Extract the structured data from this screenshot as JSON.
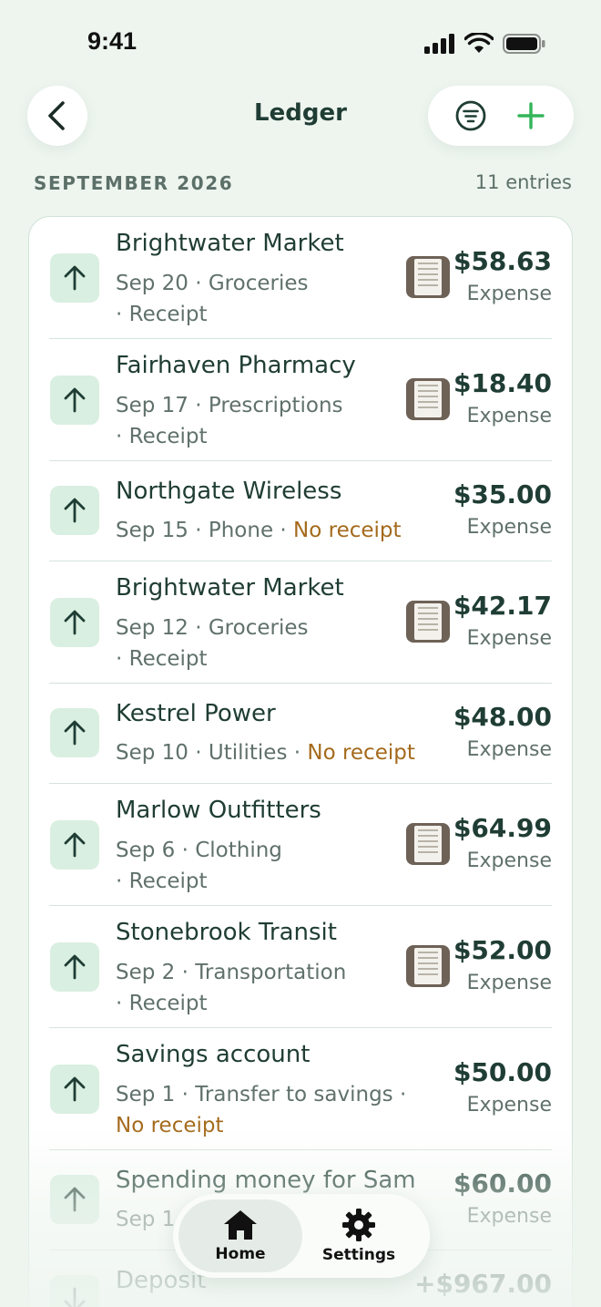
{
  "status_bar": {
    "time": "9:41"
  },
  "header": {
    "title": "Ledger"
  },
  "section": {
    "month": "SEPTEMBER 2026",
    "entries": "11 entries"
  },
  "transactions": [
    {
      "merchant": "Brightwater Market",
      "meta_line1": "Sep 20 · Groceries",
      "meta_line2": "· Receipt",
      "receipt_status": "",
      "amount": "$58.63",
      "kind": "Expense",
      "has_receipt": true
    },
    {
      "merchant": "Fairhaven Pharmacy",
      "meta_line1": "Sep 17 · Prescriptions",
      "meta_line2": "· Receipt",
      "receipt_status": "",
      "amount": "$18.40",
      "kind": "Expense",
      "has_receipt": true
    },
    {
      "merchant": "Northgate Wireless",
      "meta_line1": "Sep 15 · Phone · ",
      "meta_line2": "",
      "receipt_status": "No receipt",
      "amount": "$35.00",
      "kind": "Expense",
      "has_receipt": false
    },
    {
      "merchant": "Brightwater Market",
      "meta_line1": "Sep 12 · Groceries",
      "meta_line2": "· Receipt",
      "receipt_status": "",
      "amount": "$42.17",
      "kind": "Expense",
      "has_receipt": true
    },
    {
      "merchant": "Kestrel Power",
      "meta_line1": "Sep 10 · Utilities · ",
      "meta_line2": "",
      "receipt_status": "No receipt",
      "amount": "$48.00",
      "kind": "Expense",
      "has_receipt": false
    },
    {
      "merchant": "Marlow Outfitters",
      "meta_line1": "Sep 6 · Clothing",
      "meta_line2": "· Receipt",
      "receipt_status": "",
      "amount": "$64.99",
      "kind": "Expense",
      "has_receipt": true
    },
    {
      "merchant": "Stonebrook Transit",
      "meta_line1": "Sep 2 · Transportation",
      "meta_line2": "· Receipt",
      "receipt_status": "",
      "amount": "$52.00",
      "kind": "Expense",
      "has_receipt": true
    },
    {
      "merchant": "Savings account",
      "meta_line1": "Sep 1 · Transfer to savings ·",
      "meta_line2": "",
      "receipt_status": "No receipt",
      "amount": "$50.00",
      "kind": "Expense",
      "has_receipt": false
    },
    {
      "merchant": "Spending money for Sam",
      "meta_line1": "Sep 1",
      "meta_line2": "",
      "receipt_status": "",
      "amount": "$60.00",
      "kind": "Expense",
      "has_receipt": false
    },
    {
      "merchant": "Deposit",
      "meta_line1": "",
      "meta_line2": "",
      "receipt_status": "",
      "amount": "+$967.00",
      "kind": "",
      "has_receipt": false
    }
  ],
  "tab_bar": {
    "home_label": "Home",
    "settings_label": "Settings"
  },
  "colors": {
    "accent_green": "#34b55a",
    "no_receipt": "#a46a1c",
    "badge_bg": "#d9efe1",
    "text_dark": "#1f3d34"
  }
}
